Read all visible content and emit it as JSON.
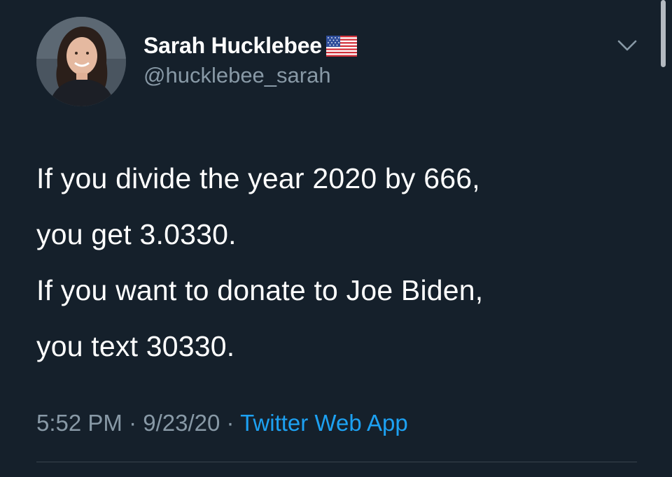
{
  "user": {
    "display_name": "Sarah Hucklebee",
    "handle": "@hucklebee_sarah",
    "badge_icon": "us-flag-icon"
  },
  "tweet": {
    "lines": [
      "If you divide the year 2020 by 666,",
      "you get 3.0330.",
      "If you want to donate to Joe Biden,",
      "you text 30330."
    ]
  },
  "meta": {
    "time": "5:52 PM",
    "sep1": " · ",
    "date": "9/23/20",
    "sep2": " · ",
    "source": "Twitter Web App"
  },
  "colors": {
    "background": "#15202b",
    "text": "#ffffff",
    "secondary": "#8899a6",
    "link": "#1da1f2",
    "divider": "#38444d"
  }
}
